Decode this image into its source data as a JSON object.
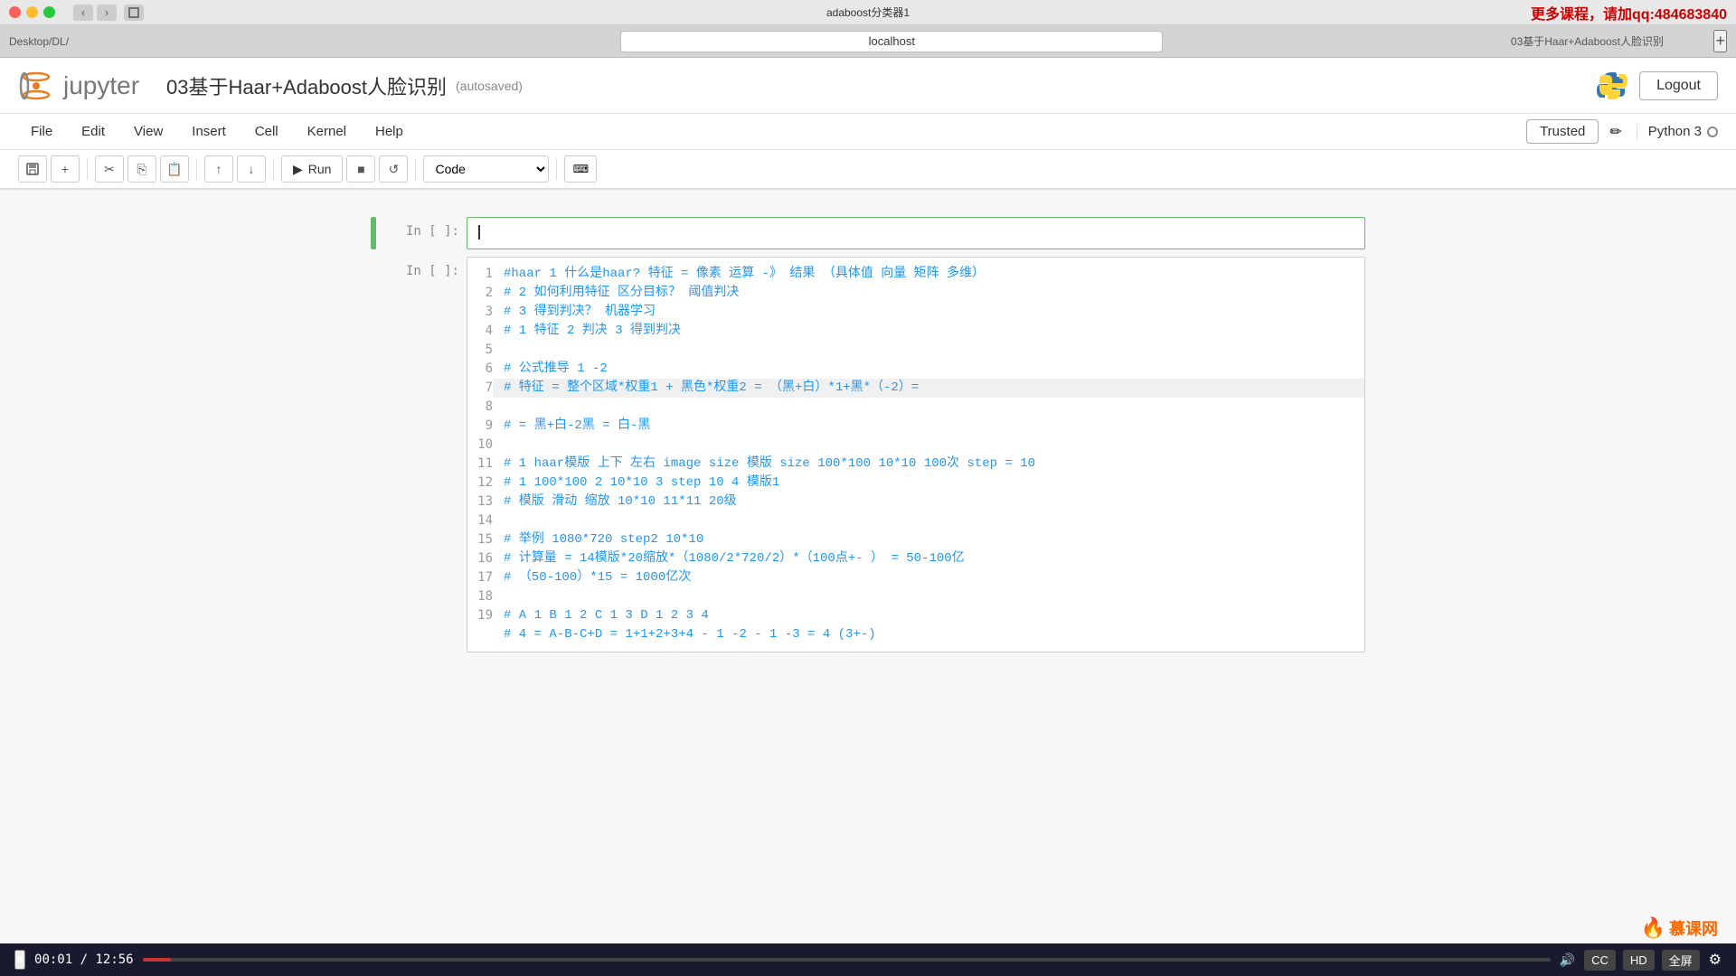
{
  "window": {
    "title": "adaboost分类器1"
  },
  "promo": {
    "text": "更多课程，请加qq:484683840"
  },
  "browser": {
    "address": "localhost",
    "tab_left": "Desktop/DL/",
    "tab_right": "03基于Haar+Adaboost人脸识别"
  },
  "jupyter": {
    "logo_text": "jupyter",
    "notebook_title": "03基于Haar+Adaboost人脸识别",
    "autosaved": "(autosaved)",
    "logout_label": "Logout"
  },
  "menu": {
    "items": [
      "File",
      "Edit",
      "View",
      "Insert",
      "Cell",
      "Kernel",
      "Help"
    ],
    "trusted_label": "Trusted",
    "kernel_label": "Python 3"
  },
  "toolbar": {
    "cell_type": "Code",
    "run_label": "Run",
    "buttons": [
      "💾",
      "+",
      "✂",
      "⎘",
      "📋",
      "⬆",
      "⬇",
      "■",
      "↺"
    ]
  },
  "cells": [
    {
      "id": "cell1",
      "prompt": "In [ ]:",
      "active": true,
      "content": "",
      "show_cursor": true
    },
    {
      "id": "cell2",
      "prompt": "In [ ]:",
      "active": false,
      "line_numbers": [
        "1",
        "2",
        "3",
        "4",
        "5",
        "6",
        "7",
        "8",
        "9",
        "10",
        "11",
        "12",
        "13",
        "14",
        "15",
        "16",
        "17",
        "18",
        "19"
      ],
      "lines": [
        {
          "text": "#haar 1 什么是haar? 特征 = 像素 运算 -》 结果  （具体值 向量 矩阵 多维）",
          "highlight": false
        },
        {
          "text": "# 2 如何利用特征 区分目标？ 阈值判决",
          "highlight": false
        },
        {
          "text": "# 3 得到判决？ 机器学习",
          "highlight": false
        },
        {
          "text": "# 1 特征 2 判决 3 得到判决",
          "highlight": false
        },
        {
          "text": "",
          "highlight": false
        },
        {
          "text": "# 公式推导 1  -2",
          "highlight": false
        },
        {
          "text": "# 特征 =  整个区域*权重1 + 黑色*权重2 =  （黑+白）*1+黑*（-2）=",
          "highlight": true
        },
        {
          "text": "# = 黑+白-2黑 = 白-黑",
          "highlight": false
        },
        {
          "text": "",
          "highlight": false
        },
        {
          "text": "# 1 haar模版 上下 左右 image size 模版 size 100*100 10*10 100次 step = 10",
          "highlight": false
        },
        {
          "text": "# 1 100*100 2 10*10 3 step 10 4 模版1",
          "highlight": false
        },
        {
          "text": "# 模版 滑动 缩放 10*10 11*11 20级",
          "highlight": false
        },
        {
          "text": "",
          "highlight": false
        },
        {
          "text": "# 举例 1080*720 step2 10*10",
          "highlight": false
        },
        {
          "text": "# 计算量 = 14模版*20缩放*（1080/2*720/2）*（100点+- ） = 50-100亿",
          "highlight": false
        },
        {
          "text": "# （50-100）*15 = 1000亿次",
          "highlight": false
        },
        {
          "text": "",
          "highlight": false
        },
        {
          "text": "# A 1 B 1 2 C 1 3 D 1 2 3 4",
          "highlight": false
        },
        {
          "text": "# 4 = A-B-C+D = 1+1+2+3+4 - 1 -2 - 1 -3 = 4 (3+-)",
          "highlight": false
        }
      ]
    }
  ],
  "bottom_bar": {
    "time_current": "00:01",
    "time_total": "12:56",
    "controls": [
      "CC",
      "HD",
      "全屏"
    ]
  },
  "watermark": {
    "text": "慕课网"
  }
}
